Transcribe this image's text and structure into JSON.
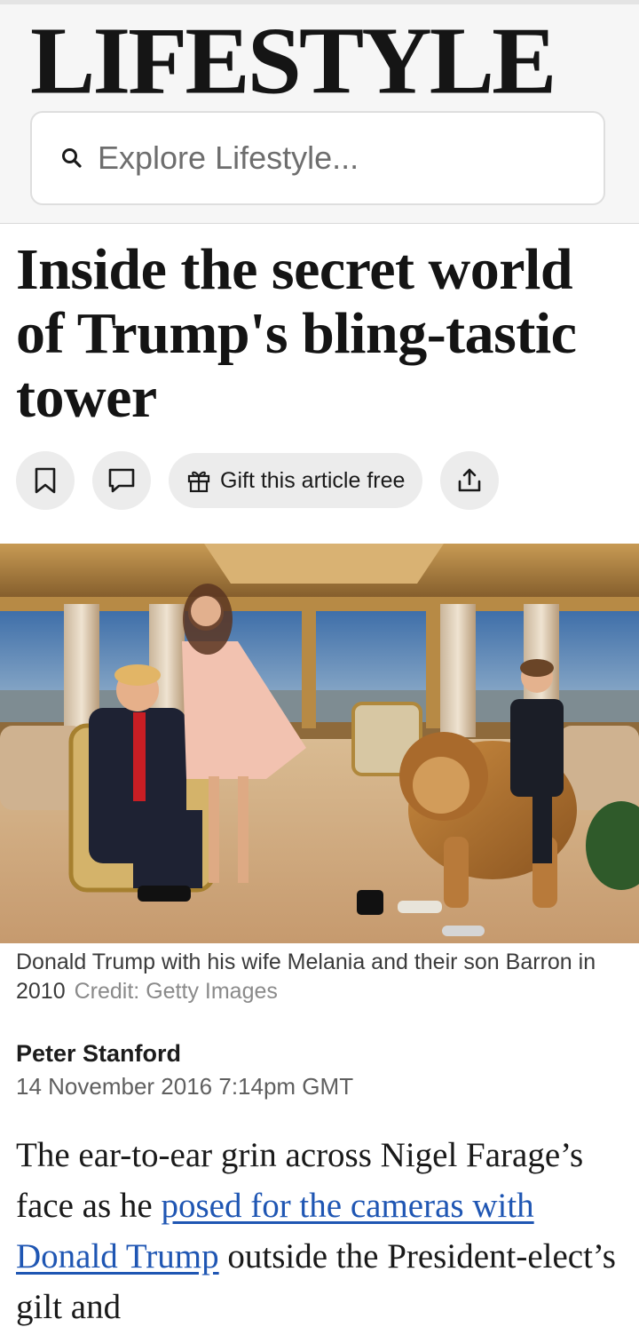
{
  "section": {
    "title": "LIFESTYLE",
    "search_placeholder": "Explore Lifestyle..."
  },
  "article": {
    "headline": "Inside the secret world of Trump's bling-tastic tower",
    "actions": {
      "bookmark_icon": "bookmark-icon",
      "comment_icon": "comment-icon",
      "gift_label": "Gift this article free",
      "share_icon": "share-icon"
    },
    "image": {
      "caption": "Donald Trump with his wife Melania and their son Barron in 2010",
      "credit": "Credit: Getty Images"
    },
    "author": "Peter Stanford",
    "date": "14 November 2016 7:14pm GMT",
    "body": {
      "text_before_link": "The ear-to-ear grin across Nigel Farage’s face as he ",
      "link_text": "posed for the cameras with Donald Trump",
      "text_after_link": " outside the President-elect’s gilt and"
    }
  },
  "colors": {
    "link": "#1f56b3",
    "header_bg": "#f6f6f6",
    "button_bg": "#ececec"
  }
}
